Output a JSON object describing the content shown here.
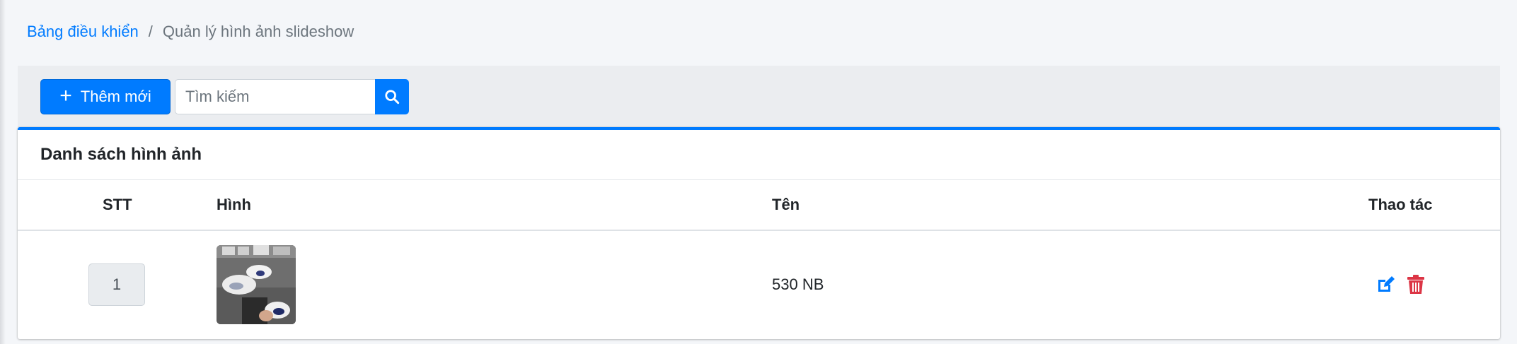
{
  "breadcrumb": {
    "home": "Bảng điều khiển",
    "separator": "/",
    "current": "Quản lý hình ảnh slideshow"
  },
  "toolbar": {
    "add_label": "Thêm mới",
    "search_placeholder": "Tìm kiếm"
  },
  "card": {
    "title": "Danh sách hình ảnh"
  },
  "table": {
    "columns": [
      "STT",
      "Hình",
      "Tên",
      "Thao tác"
    ],
    "rows": [
      {
        "stt": "1",
        "name": "530 NB"
      }
    ]
  },
  "icons": {
    "add": "plus-icon",
    "search": "search-icon",
    "edit": "edit-icon",
    "delete": "trash-icon"
  },
  "colors": {
    "primary": "#007bff",
    "danger": "#dc3545",
    "background": "#f4f6f9"
  }
}
